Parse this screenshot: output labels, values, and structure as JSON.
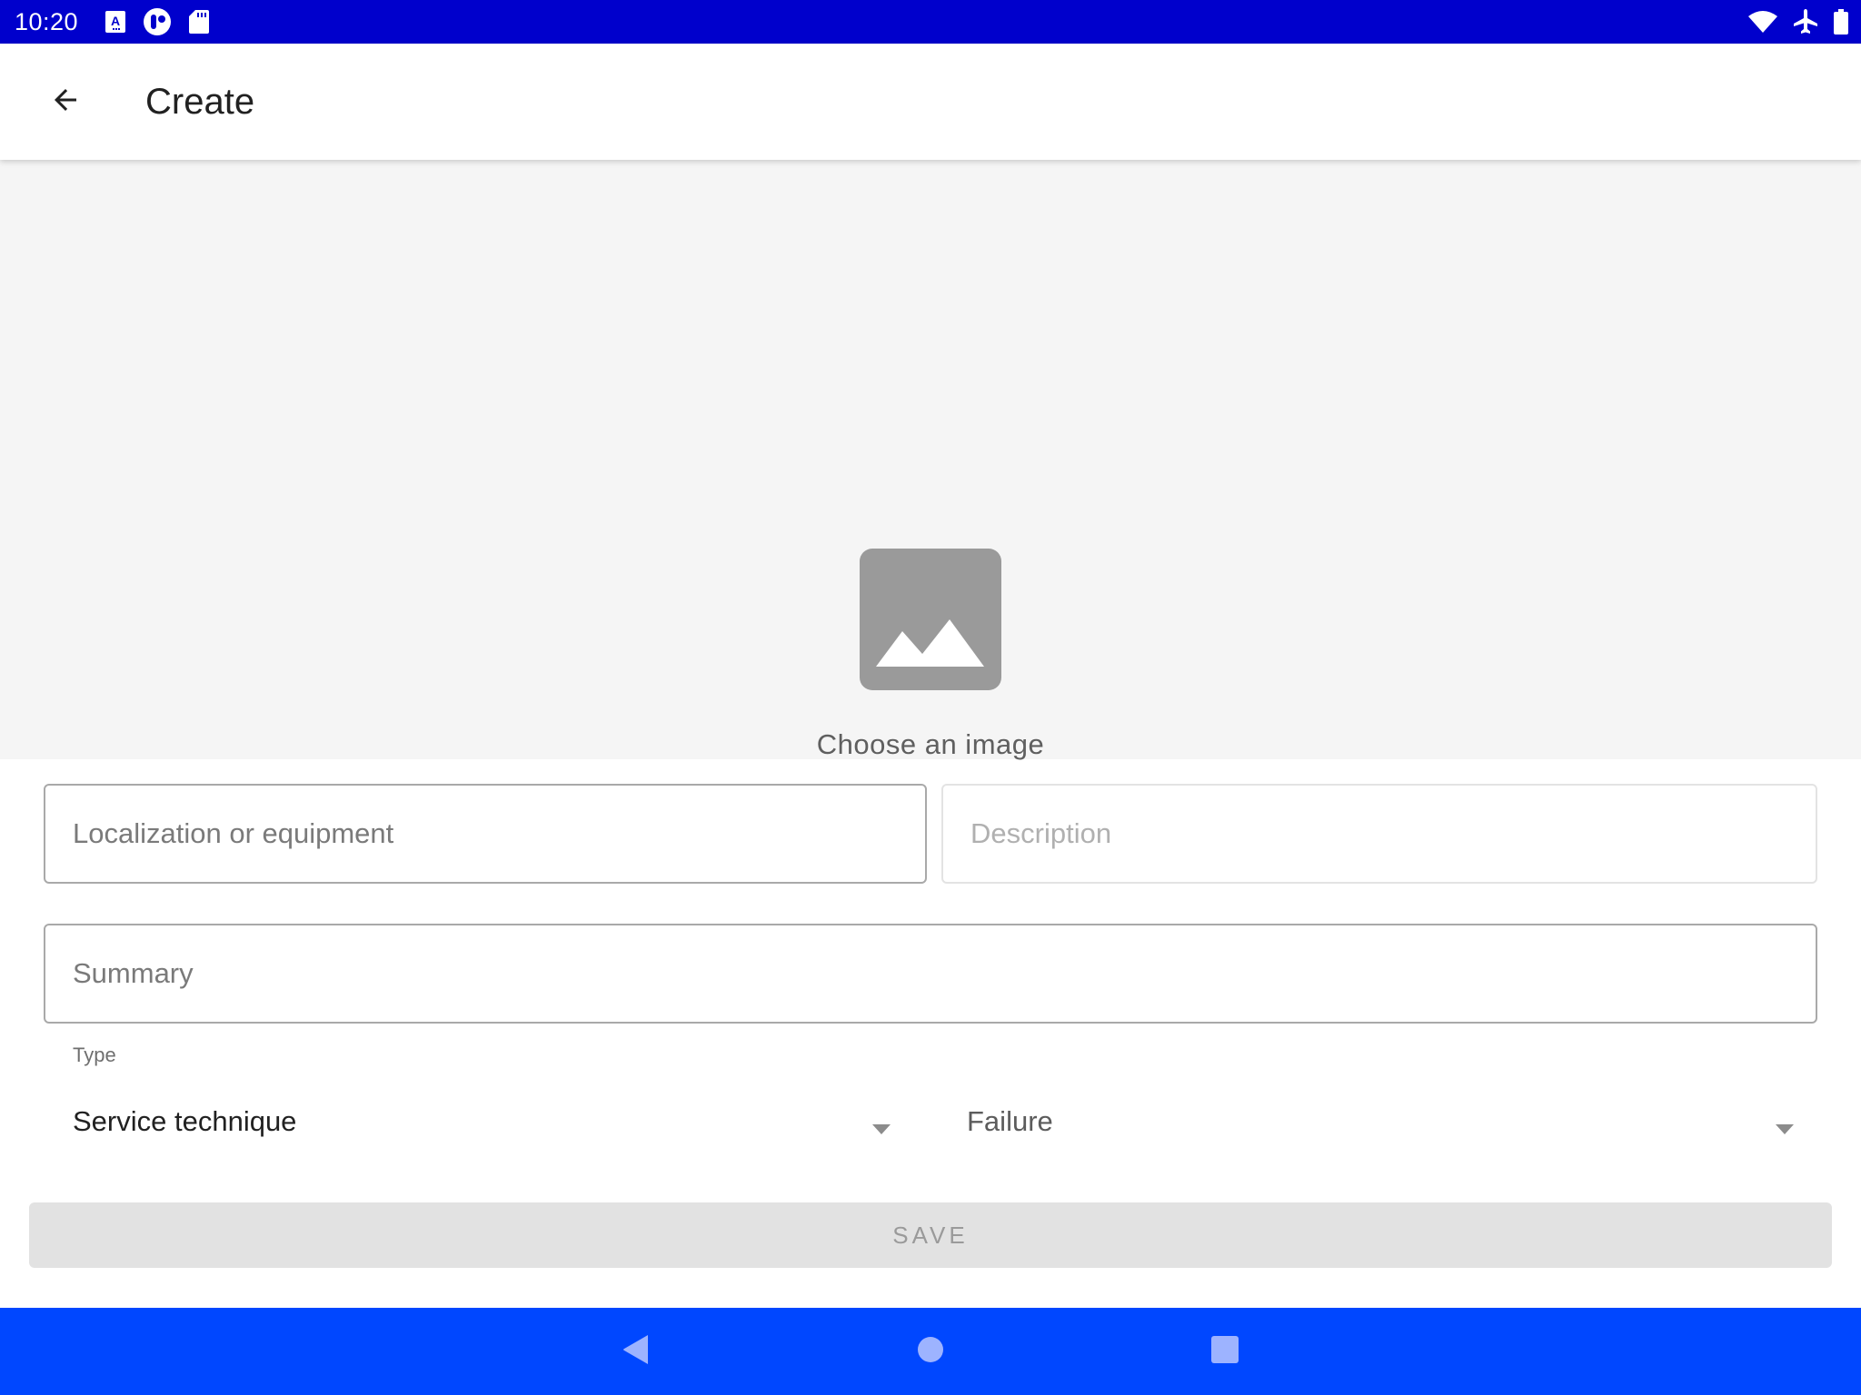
{
  "status_bar": {
    "time": "10:20",
    "left_icons": [
      "font-download-icon",
      "app-notification-icon",
      "sd-card-icon"
    ],
    "right_icons": [
      "wifi-icon",
      "airplane-mode-icon",
      "battery-icon"
    ]
  },
  "app_bar": {
    "back_icon": "arrow-left-icon",
    "title": "Create"
  },
  "image_picker": {
    "icon": "image-placeholder-icon",
    "label": "Choose an image"
  },
  "form": {
    "localization": {
      "placeholder": "Localization or equipment",
      "value": ""
    },
    "description": {
      "placeholder": "Description",
      "value": ""
    },
    "summary": {
      "placeholder": "Summary",
      "value": ""
    },
    "type_label": "Type",
    "type_select": {
      "value": "Service technique"
    },
    "category_select": {
      "value": "Failure"
    },
    "save_label": "SAVE"
  },
  "nav_bar": {
    "buttons": [
      "back-triangle-icon",
      "home-circle-icon",
      "recents-square-icon"
    ]
  },
  "colors": {
    "status_bar": "#0000cc",
    "nav_bar": "#0047ff",
    "image_area": "#f5f5f5",
    "save_disabled_bg": "#e2e2e2"
  }
}
